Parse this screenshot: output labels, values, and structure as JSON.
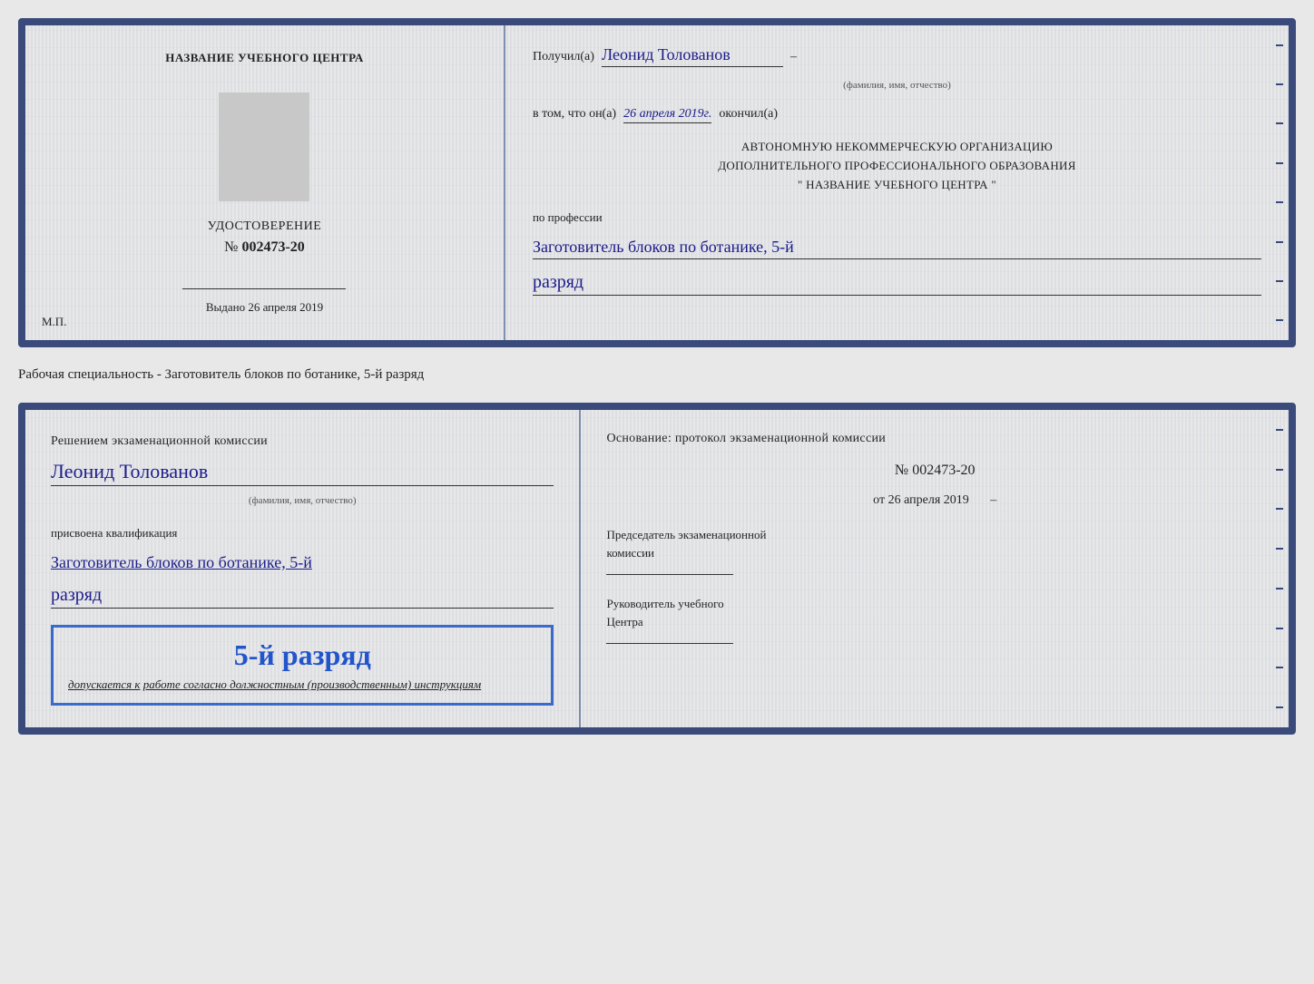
{
  "top_document": {
    "left": {
      "center_name": "НАЗВАНИЕ УЧЕБНОГО ЦЕНТРА",
      "udostoverenie": "УДОСТОВЕРЕНИЕ",
      "number_prefix": "№",
      "number": "002473-20",
      "vydano_label": "Выдано",
      "vydano_date": "26 апреля 2019",
      "mp_label": "М.П."
    },
    "right": {
      "poluchil_label": "Получил(а)",
      "name": "Леонид Толованов",
      "fio_sub": "(фамилия, имя, отчество)",
      "vtom_label": "в том, что он(а)",
      "date_italic": "26 апреля 2019г.",
      "okonchil": "окончил(а)",
      "avt_line1": "АВТОНОМНУЮ НЕКОММЕРЧЕСКУЮ ОРГАНИЗАЦИЮ",
      "avt_line2": "ДОПОЛНИТЕЛЬНОГО ПРОФЕССИОНАЛЬНОГО ОБРАЗОВАНИЯ",
      "avt_line3": "\" НАЗВАНИЕ УЧЕБНОГО ЦЕНТРА \"",
      "po_professii": "по профессии",
      "profession": "Заготовитель блоков по ботанике, 5-й",
      "razryad": "разряд"
    }
  },
  "specialty_label": "Рабочая специальность - Заготовитель блоков по ботанике, 5-й разряд",
  "bottom_document": {
    "left": {
      "resheniem": "Решением экзаменационной комиссии",
      "name": "Леонид Толованов",
      "fio_sub": "(фамилия, имя, отчество)",
      "prisvoena": "присвоена квалификация",
      "qualification": "Заготовитель блоков по ботанике, 5-й",
      "razryad": "разряд",
      "stamp_grade": "5-й разряд",
      "dopuskaetsya": "допускается к",
      "rabota_italic": "работе согласно должностным (производственным) инструкциям"
    },
    "right": {
      "osnovanie": "Основание: протокол экзаменационной комиссии",
      "number_prefix": "№",
      "number": "002473-20",
      "ot_prefix": "от",
      "ot_date": "26 апреля 2019",
      "predsedatel_line1": "Председатель экзаменационной",
      "predsedatel_line2": "комиссии",
      "rukovoditel_line1": "Руководитель учебного",
      "rukovoditel_line2": "Центра"
    }
  }
}
